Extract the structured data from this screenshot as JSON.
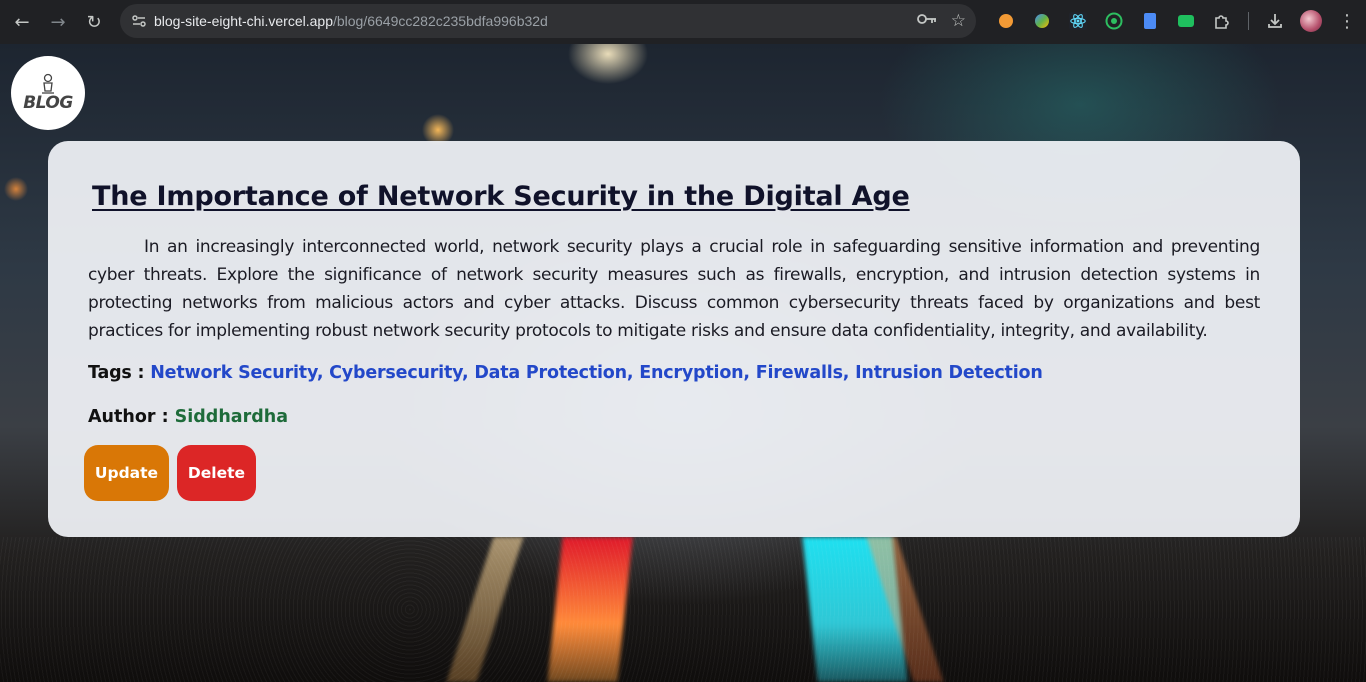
{
  "browser": {
    "url_host": "blog-site-eight-chi.vercel.app",
    "url_path": "/blog/6649cc282c235bdfa996b32d",
    "extension_colors": [
      "#f29a35",
      "#5fb24b",
      "#61dafb",
      "#2dbe60",
      "#4c8bf5",
      "#1fbf5e"
    ]
  },
  "logo": {
    "text": "BLOG"
  },
  "post": {
    "title": "The Importance of Network Security in the Digital Age",
    "body": "In an increasingly interconnected world, network security plays a crucial role in safeguarding sensitive information and preventing cyber threats. Explore the significance of network security measures such as firewalls, encryption, and intrusion detection systems in protecting networks from malicious actors and cyber attacks. Discuss common cybersecurity threats faced by organizations and best practices for implementing robust network security protocols to mitigate risks and ensure data confidentiality, integrity, and availability.",
    "tags_label": "Tags :",
    "tags": "Network Security, Cybersecurity, Data Protection, Encryption, Firewalls, Intrusion Detection",
    "author_label": "Author :",
    "author": "Siddhardha"
  },
  "actions": {
    "update_label": "Update",
    "delete_label": "Delete"
  },
  "colors": {
    "update_button": "#d97706",
    "delete_button": "#dc2626",
    "tags_text": "#2348c9",
    "author_text": "#1e6b3a"
  }
}
